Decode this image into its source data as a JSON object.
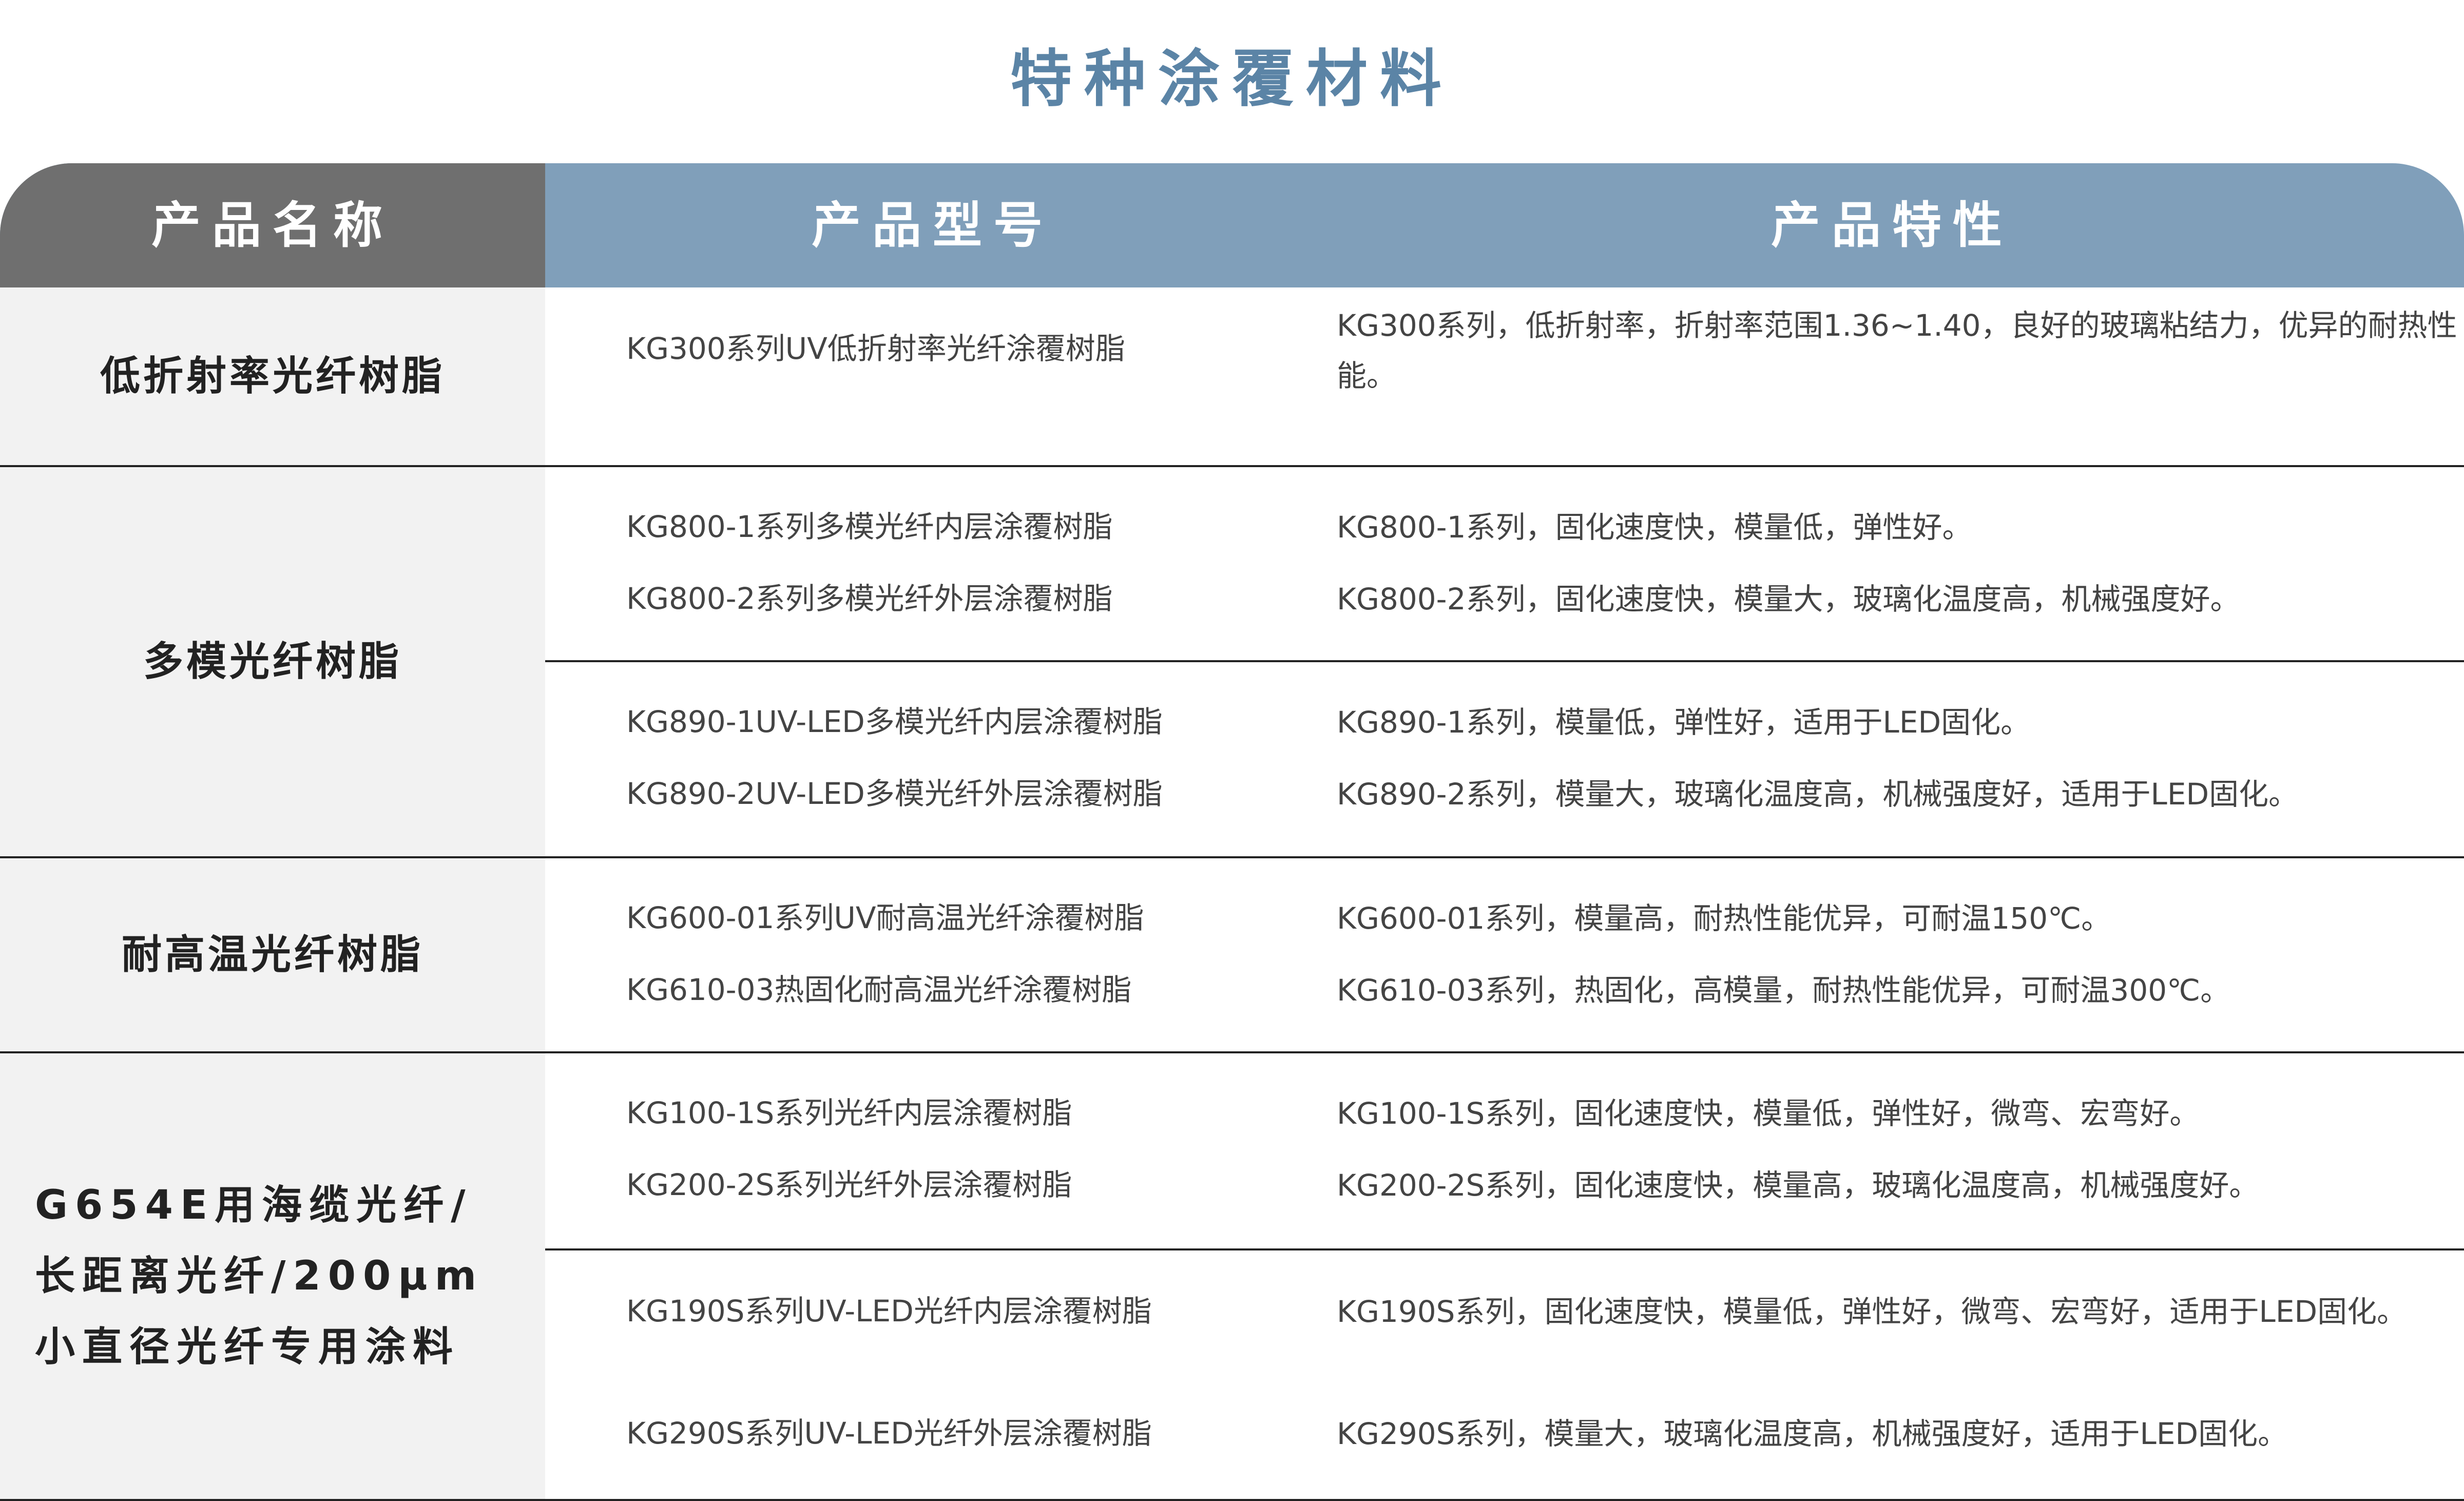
{
  "title": "特种涂覆材料",
  "columns": {
    "name": "产品名称",
    "model": "产品型号",
    "feature": "产品特性"
  },
  "groups": [
    {
      "name": "低折射率光纤树脂",
      "items": [
        {
          "model": "KG300系列UV低折射率光纤涂覆树脂",
          "feature": "KG300系列，低折射率，折射率范围1.36~1.40，良好的玻璃粘结力，优异的耐热性能。"
        }
      ]
    },
    {
      "name": "多模光纤树脂",
      "items": [
        {
          "model": "KG800-1系列多模光纤内层涂覆树脂",
          "feature": "KG800-1系列，固化速度快，模量低，弹性好。"
        },
        {
          "model": "KG800-2系列多模光纤外层涂覆树脂",
          "feature": "KG800-2系列，固化速度快，模量大，玻璃化温度高，机械强度好。"
        },
        {
          "model": "KG890-1UV-LED多模光纤内层涂覆树脂",
          "feature": "KG890-1系列，模量低，弹性好，适用于LED固化。"
        },
        {
          "model": "KG890-2UV-LED多模光纤外层涂覆树脂",
          "feature": "KG890-2系列，模量大，玻璃化温度高，机械强度好，适用于LED固化。"
        }
      ]
    },
    {
      "name": "耐高温光纤树脂",
      "items": [
        {
          "model": "KG600-01系列UV耐高温光纤涂覆树脂",
          "feature": "KG600-01系列，模量高，耐热性能优异，可耐温150℃。"
        },
        {
          "model": "KG610-03热固化耐高温光纤涂覆树脂",
          "feature": "KG610-03系列，热固化，高模量，耐热性能优异，可耐温300℃。"
        }
      ]
    },
    {
      "name_lines": [
        "G654E用海缆光纤/",
        "长距离光纤/200μm",
        "小直径光纤专用涂料"
      ],
      "items": [
        {
          "model": "KG100-1S系列光纤内层涂覆树脂",
          "feature": "KG100-1S系列，固化速度快，模量低，弹性好，微弯、宏弯好。"
        },
        {
          "model": "KG200-2S系列光纤外层涂覆树脂",
          "feature": "KG200-2S系列，固化速度快，模量高，玻璃化温度高，机械强度好。"
        },
        {
          "model": "KG190S系列UV-LED光纤内层涂覆树脂",
          "feature": "KG190S系列，固化速度快，模量低，弹性好，微弯、宏弯好，适用于LED固化。"
        },
        {
          "model": "KG290S系列UV-LED光纤外层涂覆树脂",
          "feature": "KG290S系列，模量大，玻璃化温度高，机械强度好，适用于LED固化。"
        }
      ]
    }
  ]
}
